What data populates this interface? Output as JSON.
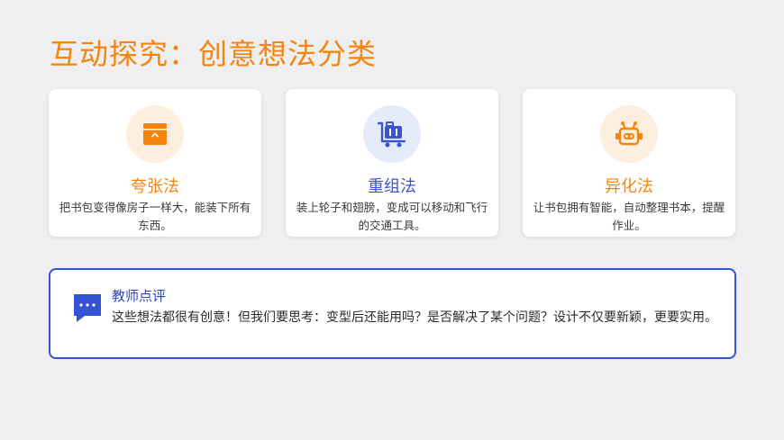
{
  "page": {
    "title": "互动探究：创意想法分类"
  },
  "cards": [
    {
      "icon": "box-icon",
      "title": "夸张法",
      "description": "把书包变得像房子一样大，能装下所有东西。",
      "accent": "#f5840f"
    },
    {
      "icon": "luggage-cart-icon",
      "title": "重组法",
      "description": "装上轮子和翅膀，变成可以移动和飞行的交通工具。",
      "accent": "#3c55c8"
    },
    {
      "icon": "robot-icon",
      "title": "异化法",
      "description": "让书包拥有智能，自动整理书本，提醒作业。",
      "accent": "#f5840f"
    }
  ],
  "review": {
    "icon": "comment-dots-icon",
    "title": "教师点评",
    "text": "这些想法都很有创意！但我们要思考：变型后还能用吗？是否解决了某个问题？设计不仅要新颖，更要实用。",
    "accent": "#3452d4"
  }
}
